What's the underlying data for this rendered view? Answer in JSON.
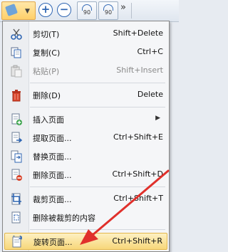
{
  "toolbar": {
    "rotate_left_text": "90",
    "rotate_right_text": "90",
    "more_glyph": "»"
  },
  "menu": {
    "items": [
      {
        "label": "剪切(T)",
        "shortcut": "Shift+Delete",
        "icon": "scissors-icon"
      },
      {
        "label": "复制(C)",
        "shortcut": "Ctrl+C",
        "icon": "copy-icon"
      },
      {
        "label": "粘贴(P)",
        "shortcut": "Shift+Insert",
        "icon": "paste-icon",
        "disabled": true
      },
      {
        "label": "删除(D)",
        "shortcut": "Delete",
        "icon": "trash-icon"
      },
      {
        "label": "插入页面",
        "shortcut": "",
        "icon": "insert-page-icon",
        "submenu": true
      },
      {
        "label": "提取页面...",
        "shortcut": "Ctrl+Shift+E",
        "icon": "extract-page-icon"
      },
      {
        "label": "替换页面...",
        "shortcut": "",
        "icon": "replace-page-icon"
      },
      {
        "label": "删除页面...",
        "shortcut": "Ctrl+Shift+D",
        "icon": "delete-page-icon"
      },
      {
        "label": "裁剪页面...",
        "shortcut": "Ctrl+Shift+T",
        "icon": "crop-page-icon"
      },
      {
        "label": "删除被裁剪的内容",
        "shortcut": "",
        "icon": "remove-cropped-icon"
      },
      {
        "label": "旋转页面...",
        "shortcut": "Ctrl+Shift+R",
        "icon": "rotate-page-icon",
        "highlighted": true
      }
    ]
  },
  "colors": {
    "highlight": "#f7d77a",
    "annotation_arrow": "#e0302b",
    "accent_blue": "#2f66b3"
  }
}
